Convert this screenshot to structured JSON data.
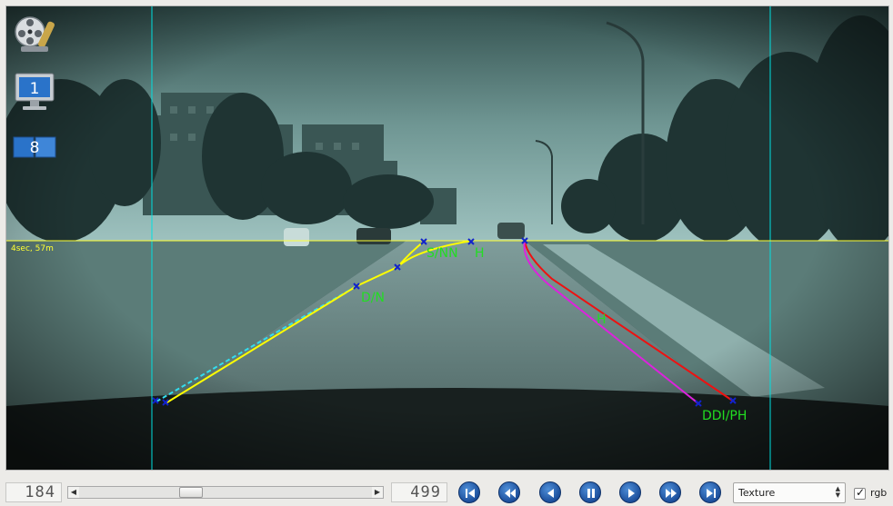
{
  "overlay": {
    "time_label": "4sec, 57m",
    "labels": {
      "left_upper": "S/NN",
      "left_upper_h": "H",
      "left_lower": "D/N",
      "right_middle": "H",
      "right_lower": "DDI/PH"
    },
    "colors": {
      "horizon": "#ffff33",
      "guides": "#00e0e0",
      "left_lane": "#ffff00",
      "left_lane_dashed": "#33ddee",
      "right_lane_outer": "#ee1111",
      "right_lane_inner": "#dd22dd",
      "markers": "#1122cc",
      "labels": "#22dd22"
    }
  },
  "sidebar": {
    "icons": [
      "film-reel-icon",
      "monitor-1-icon",
      "screens-8-icon"
    ],
    "monitor_number": "1",
    "screens_number": "8"
  },
  "controls": {
    "current_frame": "184",
    "total_frames": "499",
    "slider_position": 0.37,
    "buttons": [
      "skip-to-start",
      "fast-rewind",
      "step-back",
      "pause",
      "play",
      "fast-forward",
      "skip-to-end"
    ],
    "mode_value": "Texture",
    "rgb_checked": true,
    "rgb_label": "rgb",
    "accent": "#1c4f9c"
  }
}
